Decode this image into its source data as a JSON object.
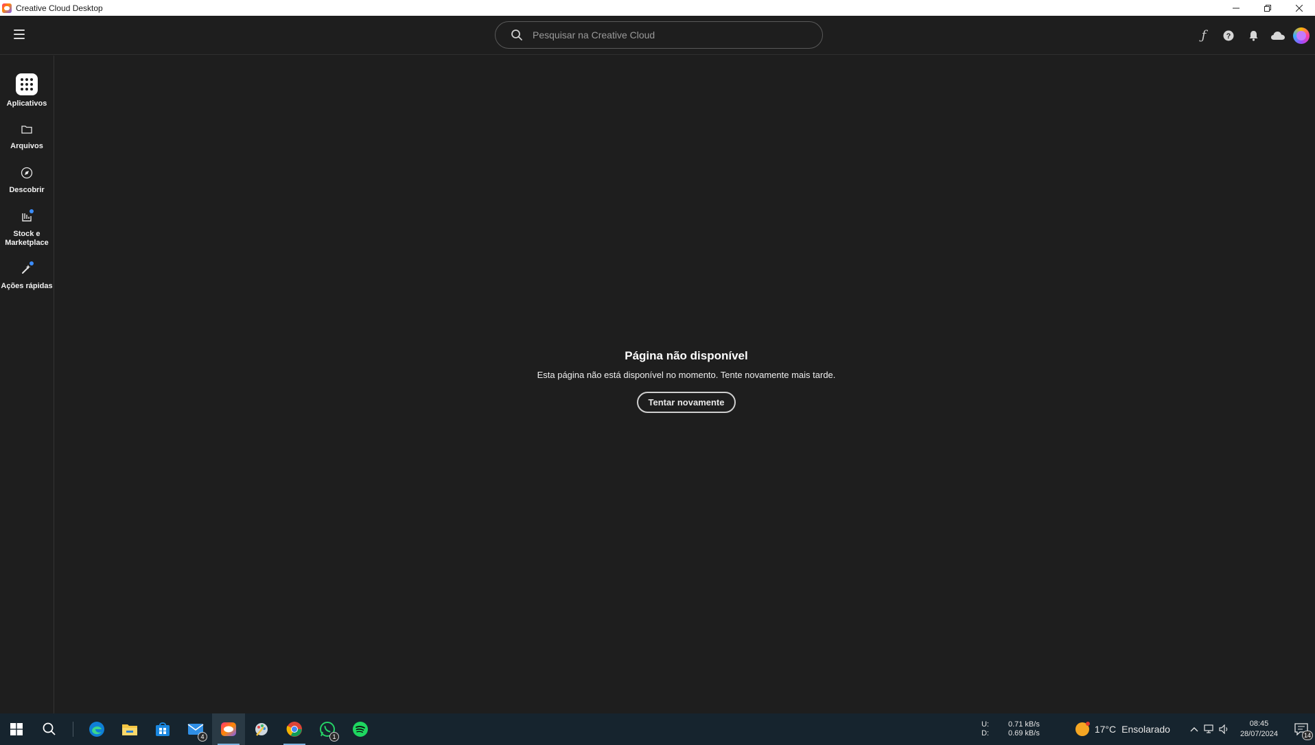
{
  "window": {
    "title": "Creative Cloud Desktop"
  },
  "header": {
    "search_placeholder": "Pesquisar na Creative Cloud"
  },
  "sidebar": {
    "items": [
      {
        "label": "Aplicativos",
        "icon": "apps-grid-icon"
      },
      {
        "label": "Arquivos",
        "icon": "folder-icon"
      },
      {
        "label": "Descobrir",
        "icon": "compass-icon"
      },
      {
        "label": "Stock e Marketplace",
        "icon": "stock-icon"
      },
      {
        "label": "Ações rápidas",
        "icon": "quick-actions-icon"
      }
    ]
  },
  "main": {
    "error_title": "Página não disponível",
    "error_message": "Esta página não está disponível no momento. Tente novamente mais tarde.",
    "retry_label": "Tentar novamente"
  },
  "taskbar": {
    "mail_badge": "4",
    "whatsapp_badge": "1",
    "network": {
      "upload_label": "U:",
      "download_label": "D:",
      "upload_rate": "0.71 kB/s",
      "download_rate": "0.69 kB/s"
    },
    "weather": {
      "temperature": "17°C",
      "condition": "Ensolarado"
    },
    "time": "08:45",
    "date": "28/07/2024",
    "notifications_count": "14"
  },
  "colors": {
    "background": "#1e1e1e",
    "accent_blue": "#3b8dff",
    "taskbar": "#16242e"
  }
}
